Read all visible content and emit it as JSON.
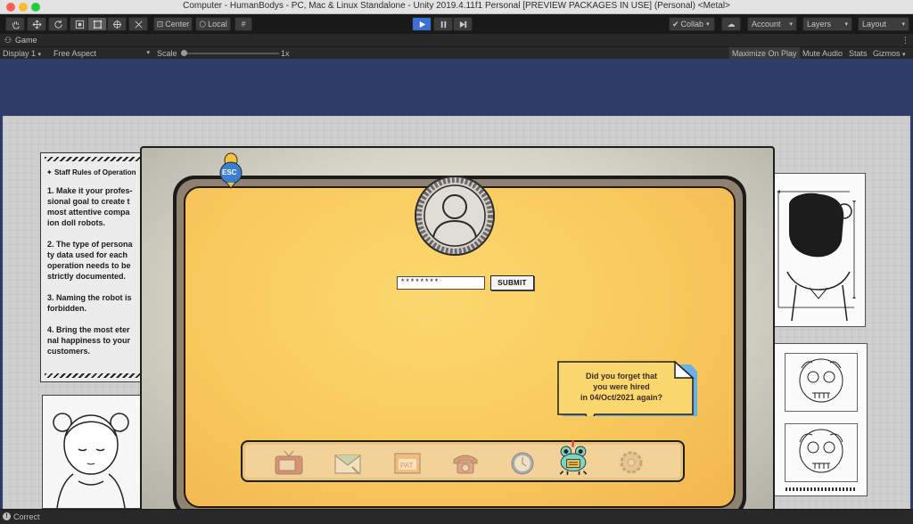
{
  "window": {
    "title": "Computer - HumanBodys - PC, Mac & Linux Standalone - Unity 2019.4.11f1 Personal [PREVIEW PACKAGES IN USE] (Personal) <Metal>"
  },
  "colors": {
    "accent_play": "#3b6fd8",
    "screen_yellow": "#f8c95c",
    "bubble_yellow": "#fbd86e",
    "bubble_shadow": "#6ab2e6"
  },
  "toolbar": {
    "pivot_center": "Center",
    "pivot_local": "Local",
    "collab": "Collab",
    "account": "Account",
    "layers": "Layers",
    "layout": "Layout"
  },
  "game_panel": {
    "tab": "Game",
    "display": "Display 1",
    "aspect": "Free Aspect",
    "scale_label": "Scale",
    "scale_value": "1x",
    "scale_fraction": 0.0,
    "maximize": "Maximize On Play",
    "mute": "Mute Audio",
    "stats": "Stats",
    "gizmos": "Gizmos"
  },
  "rules": {
    "title": "Staff Rules of Operation",
    "items": [
      "1. Make it your profes-\nsional goal to create t\nmost attentive compa\nion doll robots.",
      "2. The type of persona\nty data used for each\noperation needs to be\nstrictly documented.",
      "3. Naming the robot is\nforbidden.",
      "4. Bring the most eter\nnal happiness to your\ncustomers."
    ]
  },
  "login": {
    "password_value": "********",
    "submit": "SUBMIT"
  },
  "hint": {
    "text": "Did you forget  that\nyou were hired\nin 04/Oct/2021 again?"
  },
  "esc_badge": "ESC",
  "dock_apps": [
    {
      "name": "tv-icon",
      "active": false
    },
    {
      "name": "mail-icon",
      "active": false
    },
    {
      "name": "calendar-icon",
      "active": false
    },
    {
      "name": "phone-icon",
      "active": false
    },
    {
      "name": "clock-icon",
      "active": false
    },
    {
      "name": "frog-assistant-icon",
      "active": true
    },
    {
      "name": "settings-icon",
      "active": false
    }
  ],
  "status": {
    "message": "Correct"
  }
}
